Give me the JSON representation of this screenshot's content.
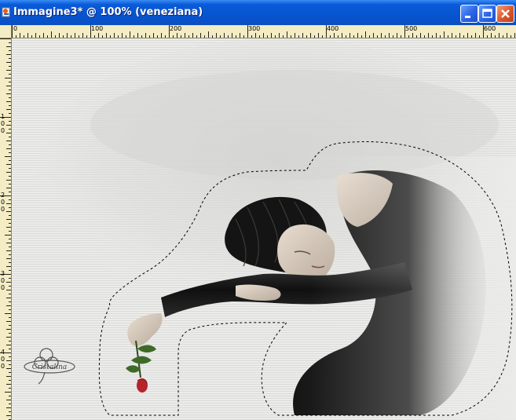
{
  "window": {
    "title": "Immagine3* @ 100% (veneziana)",
    "buttons": {
      "minimize": "minimize-icon",
      "maximize": "maximize-icon",
      "close": "close-icon"
    }
  },
  "ruler": {
    "horizontal_labels": [
      "0",
      "100",
      "200",
      "300",
      "400",
      "500",
      "600"
    ],
    "vertical_labels": [
      "1",
      "0",
      "0",
      "2",
      "0",
      "0",
      "3",
      "0",
      "0",
      "4",
      "0",
      "0"
    ]
  },
  "canvas": {
    "watermark": "Cristalina",
    "colors": {
      "background": "#ebebea",
      "stripe": "#dcdcda",
      "dress": "#1c1c1c",
      "rose": "#b8232a"
    }
  }
}
